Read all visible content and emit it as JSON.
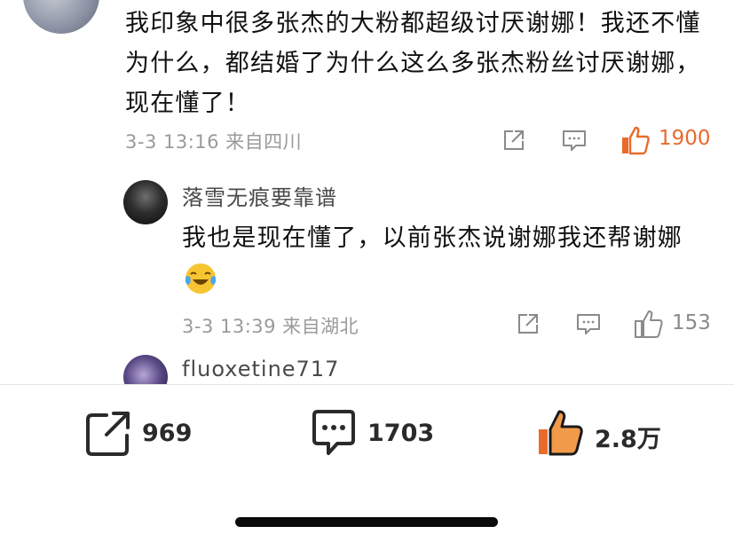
{
  "comment": {
    "text": "我印象中很多张杰的大粉都超级讨厌谢娜！我还不懂为什么，都结婚了为什么这么多张杰粉丝讨厌谢娜，现在懂了！",
    "meta": "3-3 13:16  来自四川",
    "like_count": "1900",
    "liked": true
  },
  "replies": [
    {
      "username": "落雪无痕要靠谱",
      "text": "我也是现在懂了，以前张杰说谢娜我还帮谢娜",
      "emoji": "laughing-crying-emoji",
      "meta": "3-3 13:39  来自湖北",
      "like_count": "153"
    },
    {
      "username": "fluoxetine717"
    }
  ],
  "bottom_bar": {
    "repost_count": "969",
    "comment_count": "1703",
    "like_count": "2.8万"
  },
  "colors": {
    "accent_orange": "#e86b2b",
    "meta_gray": "#9a9a9a",
    "text": "#111111"
  },
  "icons": [
    "share-icon",
    "comment-icon",
    "thumbs-up-icon"
  ]
}
